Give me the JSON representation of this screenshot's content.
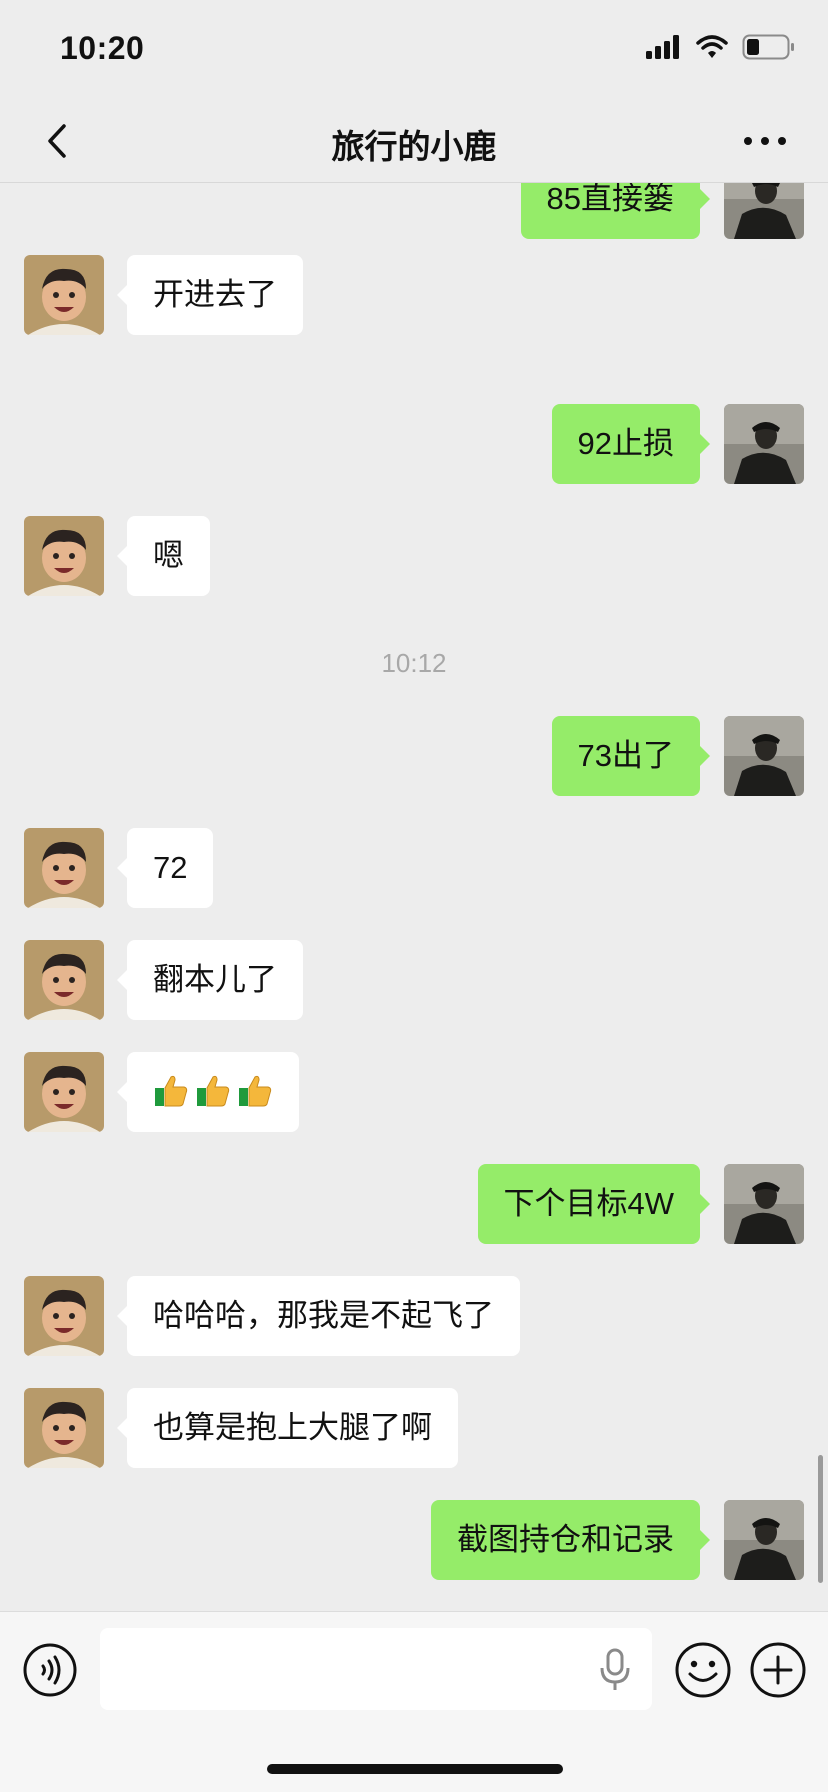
{
  "status_bar": {
    "time": "10:20"
  },
  "nav": {
    "title": "旅行的小鹿"
  },
  "messages": [
    {
      "side": "right",
      "text": "85直接篓"
    },
    {
      "side": "left",
      "text": "开进去了"
    },
    {
      "side": "right",
      "text": "92止损"
    },
    {
      "side": "left",
      "text": "嗯"
    },
    {
      "timestamp": "10:12"
    },
    {
      "side": "right",
      "text": "73出了"
    },
    {
      "side": "left",
      "text": "72"
    },
    {
      "side": "left",
      "text": "翻本儿了"
    },
    {
      "side": "left",
      "emoji": "thumbs-up x3"
    },
    {
      "side": "right",
      "text": "下个目标4W"
    },
    {
      "side": "left",
      "text": "哈哈哈，那我是不起飞了"
    },
    {
      "side": "left",
      "text": "也算是抱上大腿了啊"
    },
    {
      "side": "right",
      "text": "截图持仓和记录"
    }
  ],
  "input_bar": {
    "placeholder": ""
  },
  "colors": {
    "background": "#ededed",
    "sent_bubble": "#95ec69",
    "received_bubble": "#ffffff"
  },
  "icons": {
    "back": "chevron-left-icon",
    "more": "more-dots-icon",
    "voice": "voice-icon",
    "mic": "microphone-icon",
    "emoji": "emoji-icon",
    "plus": "plus-icon"
  }
}
